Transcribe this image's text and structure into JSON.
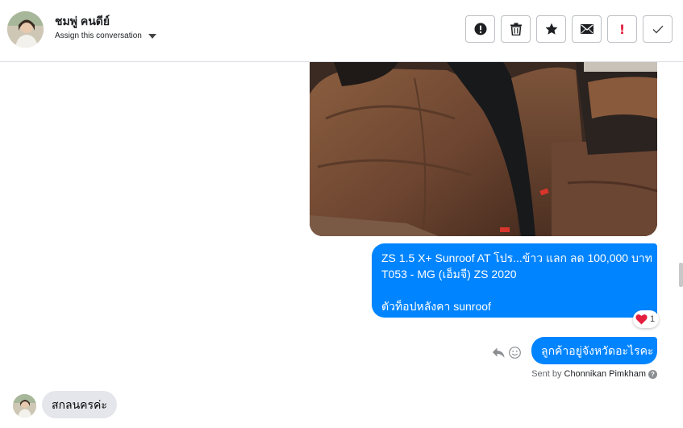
{
  "header": {
    "contact_name": "ชมพู่ คนดีย์",
    "assign_label": "Assign this conversation",
    "actions": [
      {
        "name": "report-spam",
        "icon": "alert-circle-icon"
      },
      {
        "name": "delete",
        "icon": "trash-icon"
      },
      {
        "name": "star",
        "icon": "star-icon"
      },
      {
        "name": "mark-unread",
        "icon": "envelope-icon"
      },
      {
        "name": "flag-important",
        "icon": "exclamation-icon",
        "label": "!"
      },
      {
        "name": "mark-done",
        "icon": "check-icon"
      }
    ]
  },
  "messages": {
    "outgoing_post": {
      "lines": [
        "ZS 1.5 X+ Sunroof AT โปร...ข้าว แลก ลด 100,000 บาท",
        "T053 - MG (เอ็มจี) ZS 2020",
        "ตัวท็อปหลังคา sunroof"
      ],
      "reaction_count": "1",
      "reaction_icon": "heart-icon"
    },
    "outgoing_question": "ลูกค้าอยู่จังหวัดอะไรคะ",
    "sent_by_prefix": "Sent by",
    "sent_by_agent": "Chonnikan Pimkham",
    "incoming_reply": "สกลนครค่ะ"
  },
  "colors": {
    "outgoing_bubble": "#0084ff",
    "incoming_bubble": "#e4e6eb",
    "important_red": "#e41e3f"
  }
}
